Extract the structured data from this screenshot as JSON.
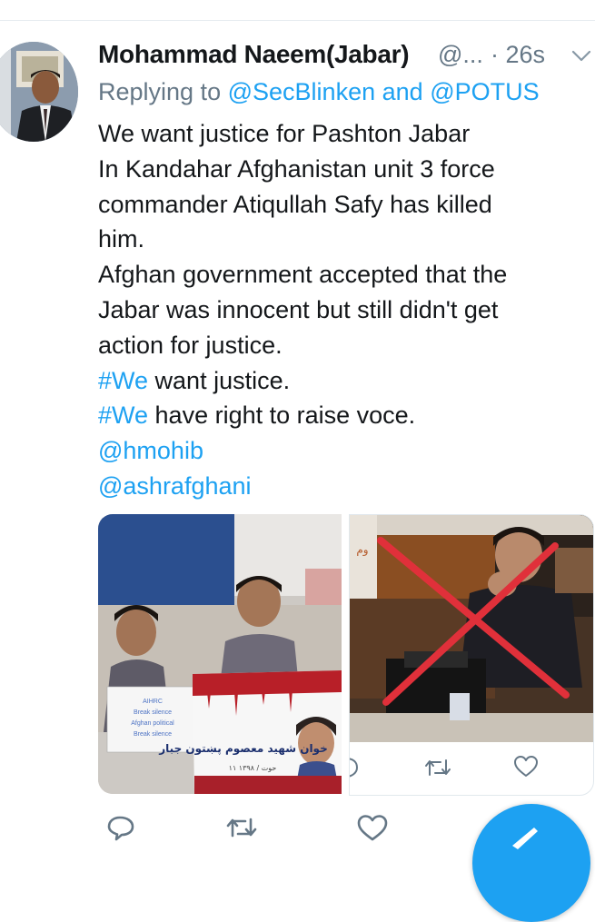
{
  "tweet": {
    "display_name": "Mohammad Naeem(Jabar)",
    "handle": "@...",
    "timestamp": "· 26s",
    "replying_prefix": "Replying to",
    "reply_user_1": "@SecBlinken",
    "reply_and": "and",
    "reply_user_2": "@POTUS",
    "lines": [
      "We want justice for Pashton Jabar",
      "In Kandahar Afghanistan unit 3 force",
      "commander Atiqullah Safy has killed",
      "him.",
      "Afghan government accepted that the",
      "Jabar was innocent but still didn't get",
      "action for justice."
    ],
    "hashtag": "#We",
    "hashtag_line_1_rest": " want justice.",
    "hashtag_line_2_rest": " have right to raise voce.",
    "mentions": [
      "@hmohib",
      "@ashrafghani"
    ]
  },
  "media": {
    "photo_1": {
      "paper_lines": [
        "AIHRC",
        "Break silence",
        "Afghan political",
        "Break silence"
      ],
      "banner_text": "خوان شهید معصوم پښتون جبار",
      "banner_date": "۱۱ حوت / ۱۳۹۸"
    },
    "photo_2": {
      "corner_text": "وم"
    }
  },
  "icons": [
    "avatar",
    "chevron-down-icon",
    "reply-icon",
    "retweet-icon",
    "like-icon",
    "compose-tweet-icon"
  ],
  "colors": {
    "link": "#1da1f2",
    "secondary_text": "#657786",
    "primary_text": "#14171a",
    "icon_gray": "#657786",
    "fab": "#1da1f2",
    "red_cross": "#e0303a"
  }
}
